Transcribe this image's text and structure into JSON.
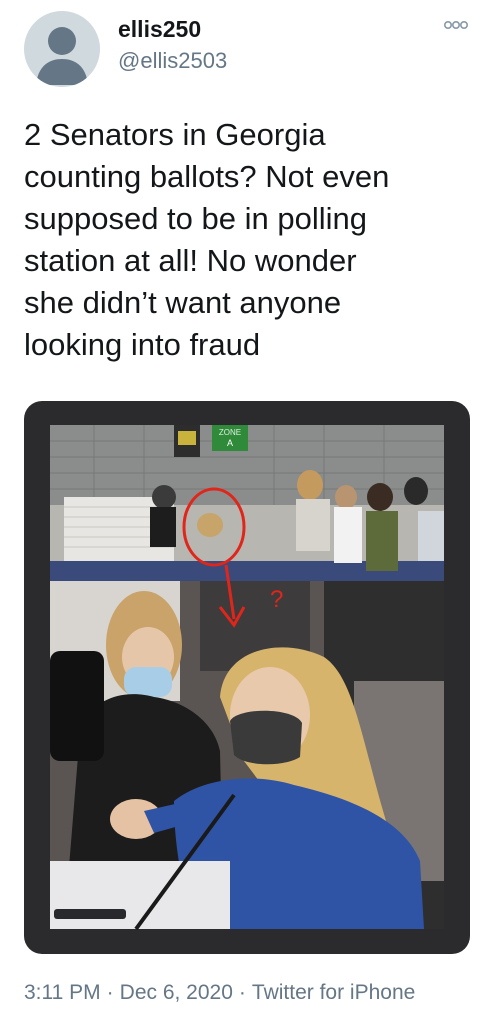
{
  "user": {
    "display_name": "ellis250",
    "handle": "@ellis2503",
    "avatar_icon": "default-profile-avatar-icon"
  },
  "more_icon": "more-options-icon",
  "tweet": {
    "text": "2 Senators in Georgia\ncounting ballots? Not even\nsupposed to be in polling\nstation at all! No wonder\nshe didn’t want anyone\nlooking into fraud"
  },
  "media": {
    "top_photo_sign_label": "ZONE\nA",
    "annotation_mark": "?",
    "annotation_color": "#e0261b"
  },
  "meta": {
    "time": "3:11 PM",
    "date": "Dec 6, 2020",
    "source": "Twitter for iPhone",
    "separator": "·"
  },
  "colors": {
    "text_primary": "#14171a",
    "text_secondary": "#657786",
    "avatar_bg": "#cfd9de",
    "media_frame": "#2b2b2d"
  }
}
